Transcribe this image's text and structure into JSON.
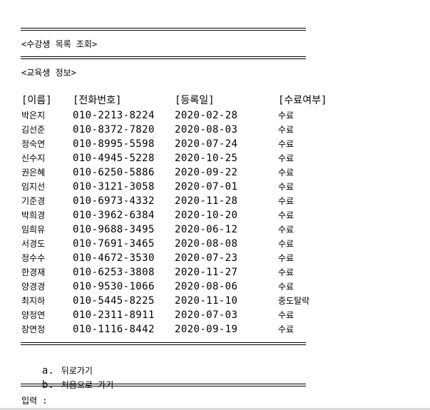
{
  "title": "<수강생 목록 조회>",
  "section": "<교육생 정보>",
  "columns": [
    "[이름]",
    "[전화번호]",
    "[등록일]",
    "[수료여부]"
  ],
  "rows": [
    {
      "name": "박은지",
      "phone": "010-2213-8224",
      "date": "2020-02-28",
      "status": "수료"
    },
    {
      "name": "김선준",
      "phone": "010-8372-7820",
      "date": "2020-08-03",
      "status": "수료"
    },
    {
      "name": "정숙연",
      "phone": "010-8995-5598",
      "date": "2020-07-24",
      "status": "수료"
    },
    {
      "name": "신수지",
      "phone": "010-4945-5228",
      "date": "2020-10-25",
      "status": "수료"
    },
    {
      "name": "권은혜",
      "phone": "010-6250-5886",
      "date": "2020-09-22",
      "status": "수료"
    },
    {
      "name": "임지선",
      "phone": "010-3121-3058",
      "date": "2020-07-01",
      "status": "수료"
    },
    {
      "name": "기준경",
      "phone": "010-6973-4332",
      "date": "2020-11-28",
      "status": "수료"
    },
    {
      "name": "박희경",
      "phone": "010-3962-6384",
      "date": "2020-10-20",
      "status": "수료"
    },
    {
      "name": "임희유",
      "phone": "010-9688-3495",
      "date": "2020-06-12",
      "status": "수료"
    },
    {
      "name": "서경도",
      "phone": "010-7691-3465",
      "date": "2020-08-08",
      "status": "수료"
    },
    {
      "name": "정수수",
      "phone": "010-4672-3530",
      "date": "2020-07-23",
      "status": "수료"
    },
    {
      "name": "한경재",
      "phone": "010-6253-3808",
      "date": "2020-11-27",
      "status": "수료"
    },
    {
      "name": "양경경",
      "phone": "010-9530-1066",
      "date": "2020-08-06",
      "status": "수료"
    },
    {
      "name": "최지하",
      "phone": "010-5445-8225",
      "date": "2020-11-10",
      "status": "중도탈락"
    },
    {
      "name": "양정연",
      "phone": "010-2311-8911",
      "date": "2020-07-03",
      "status": "수료"
    },
    {
      "name": "장연정",
      "phone": "010-1116-8442",
      "date": "2020-09-19",
      "status": "수료"
    }
  ],
  "menu": [
    {
      "key": "a.",
      "label": "뒤로가기"
    },
    {
      "key": "b.",
      "label": "처음으로 가기"
    }
  ],
  "prompt": "입력 :"
}
